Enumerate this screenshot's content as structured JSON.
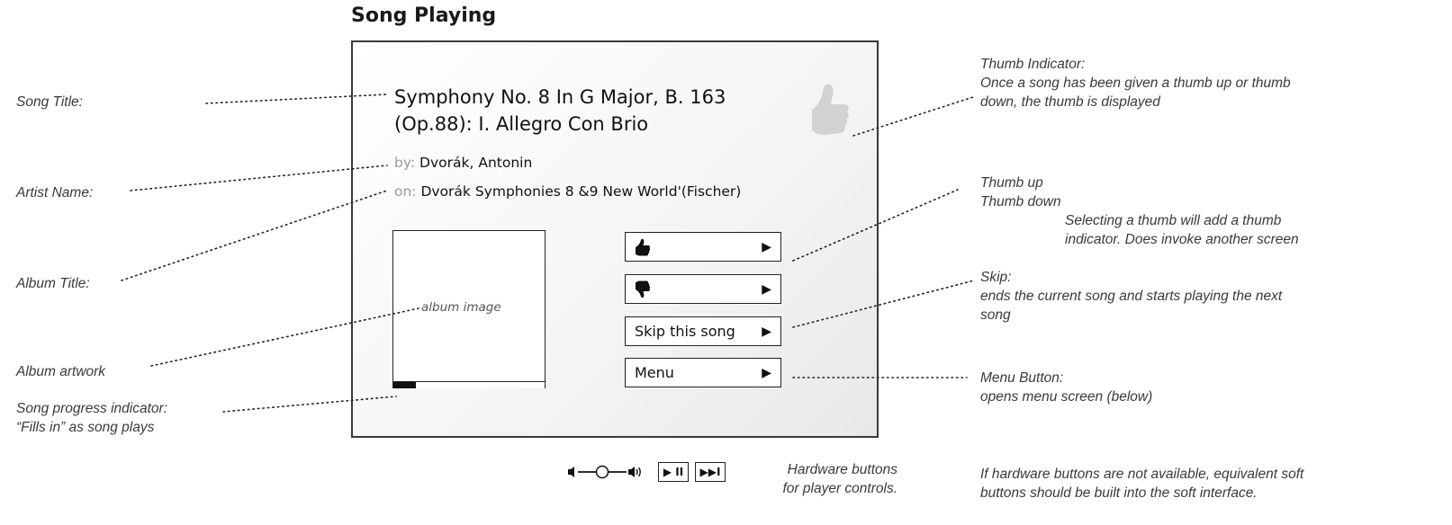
{
  "heading": "Song Playing",
  "screen": {
    "song_title_line1": "Symphony No. 8 In G Major, B. 163",
    "song_title_line2": "(Op.88): I. Allegro Con Brio",
    "artist_label": "by:",
    "artist": "Dvorák, Antonin",
    "album_label": "on:",
    "album": "Dvorák Symphonies 8 &9 New World'(Fischer)",
    "album_image_label": "album image",
    "progress_fraction": 0.15,
    "buttons": {
      "thumb_up_icon": "thumbs-up-icon",
      "thumb_down_icon": "thumbs-down-icon",
      "skip_label": "Skip this song",
      "menu_label": "Menu",
      "arrow": "▶"
    }
  },
  "left_annotations": {
    "song_title": "Song Title:",
    "artist_name": "Artist Name:",
    "album_title": "Album Title:",
    "album_artwork": "Album artwork",
    "progress_line1": "Song progress indicator:",
    "progress_line2": "“Fills in” as song plays"
  },
  "right_annotations": {
    "thumb_indicator_title": "Thumb Indicator:",
    "thumb_indicator_line1": "Once a song has been given a thumb up or thumb",
    "thumb_indicator_line2": "down, the thumb is displayed",
    "thumb_up": "Thumb up",
    "thumb_down": "Thumb down",
    "thumb_note_line1": "Selecting a thumb will add a thumb",
    "thumb_note_line2": "indicator. Does invoke another screen",
    "skip_title": "Skip:",
    "skip_line1": "ends the current song and starts playing the next",
    "skip_line2": "song",
    "menu_title": "Menu  Button:",
    "menu_line1": "opens menu screen  (below)"
  },
  "hardware": {
    "play_pause": "▶ II",
    "next": "▶▶I",
    "note_line1": "Hardware buttons",
    "note_line2": "for player controls.",
    "soft_note_line1": "If hardware buttons are not available, equivalent soft",
    "soft_note_line2": "buttons should be built into the soft interface."
  }
}
